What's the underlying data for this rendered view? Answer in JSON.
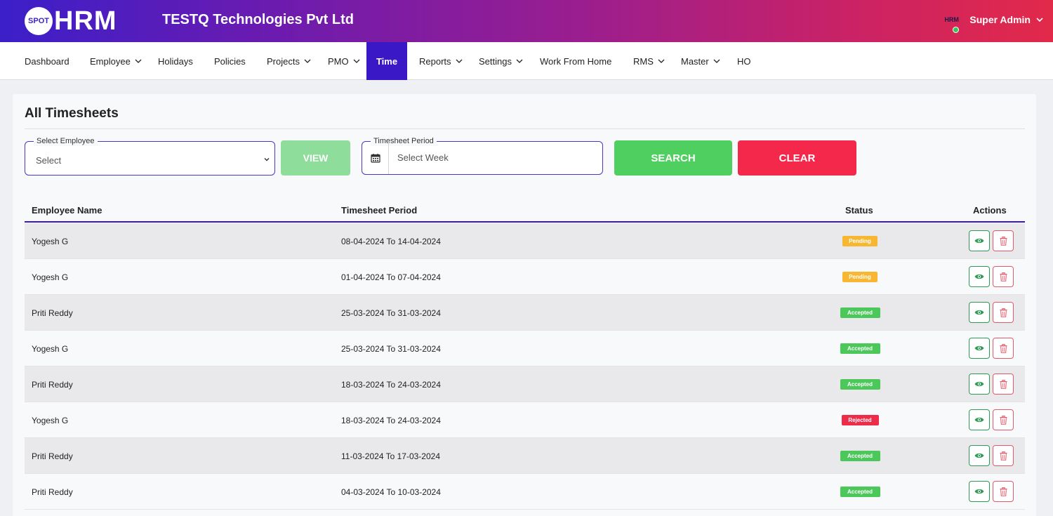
{
  "header": {
    "logo_badge": "SPOT",
    "logo_text": "HRM",
    "company": "TESTQ Technologies Pvt Ltd",
    "user_avatar_text": "HRM",
    "user_name": "Super Admin"
  },
  "nav": {
    "items": [
      {
        "label": "Dashboard",
        "dropdown": false
      },
      {
        "label": "Employee",
        "dropdown": true
      },
      {
        "label": "Holidays",
        "dropdown": false
      },
      {
        "label": "Policies",
        "dropdown": false
      },
      {
        "label": "Projects",
        "dropdown": true
      },
      {
        "label": "PMO",
        "dropdown": true
      },
      {
        "label": "Time",
        "dropdown": false,
        "active": true
      },
      {
        "label": "Reports",
        "dropdown": true
      },
      {
        "label": "Settings",
        "dropdown": true
      },
      {
        "label": "Work From Home",
        "dropdown": false
      },
      {
        "label": "RMS",
        "dropdown": true
      },
      {
        "label": "Master",
        "dropdown": true
      },
      {
        "label": "HO",
        "dropdown": false
      }
    ]
  },
  "page": {
    "title": "All Timesheets"
  },
  "filters": {
    "employee_legend": "Select Employee",
    "employee_value": "Select",
    "view_label": "VIEW",
    "period_legend": "Timesheet Period",
    "period_placeholder": "Select Week",
    "search_label": "SEARCH",
    "clear_label": "CLEAR"
  },
  "table": {
    "headers": {
      "name": "Employee Name",
      "period": "Timesheet Period",
      "status": "Status",
      "actions": "Actions"
    },
    "rows": [
      {
        "name": "Yogesh G",
        "period": "08-04-2024 To 14-04-2024",
        "status": "Pending"
      },
      {
        "name": "Yogesh G",
        "period": "01-04-2024 To 07-04-2024",
        "status": "Pending"
      },
      {
        "name": "Priti Reddy",
        "period": "25-03-2024 To 31-03-2024",
        "status": "Accepted"
      },
      {
        "name": "Yogesh G",
        "period": "25-03-2024 To 31-03-2024",
        "status": "Accepted"
      },
      {
        "name": "Priti Reddy",
        "period": "18-03-2024 To 24-03-2024",
        "status": "Accepted"
      },
      {
        "name": "Yogesh G",
        "period": "18-03-2024 To 24-03-2024",
        "status": "Rejected"
      },
      {
        "name": "Priti Reddy",
        "period": "11-03-2024 To 17-03-2024",
        "status": "Accepted"
      },
      {
        "name": "Priti Reddy",
        "period": "04-03-2024 To 10-03-2024",
        "status": "Accepted"
      }
    ]
  },
  "colors": {
    "accent": "#3a18c6",
    "pending": "#f7b733",
    "accepted": "#4cc75a",
    "rejected": "#ee2c4a",
    "view_icon": "#2e9a55",
    "delete_icon": "#e8566a"
  },
  "icons": {
    "calendar": "calendar-icon",
    "view": "eye-icon",
    "delete": "trash-icon",
    "dropdown": "chevron-down-icon"
  }
}
